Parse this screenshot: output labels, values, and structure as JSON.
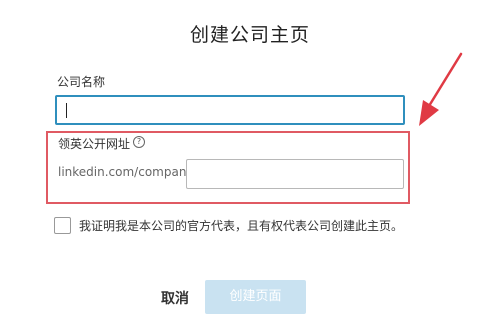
{
  "dialog": {
    "title": "创建公司主页",
    "company_name_label": "公司名称",
    "company_name_value": "",
    "linkedin_url_label": "领英公开网址",
    "help_icon": "?",
    "url_prefix": "linkedin.com/company/",
    "url_value": "",
    "confirm_checked": false,
    "confirm_text": "我证明我是本公司的官方代表，且有权代表公司创建此主页。",
    "cancel_label": "取消",
    "create_label": "创建页面"
  },
  "colors": {
    "focus_border": "#2f8fbd",
    "highlight_border": "#e05a63",
    "arrow": "#e03a44",
    "create_button_disabled": "#c9e2f1"
  },
  "icons": {
    "annotation": "red-arrow-icon",
    "help": "question-circle-icon"
  }
}
